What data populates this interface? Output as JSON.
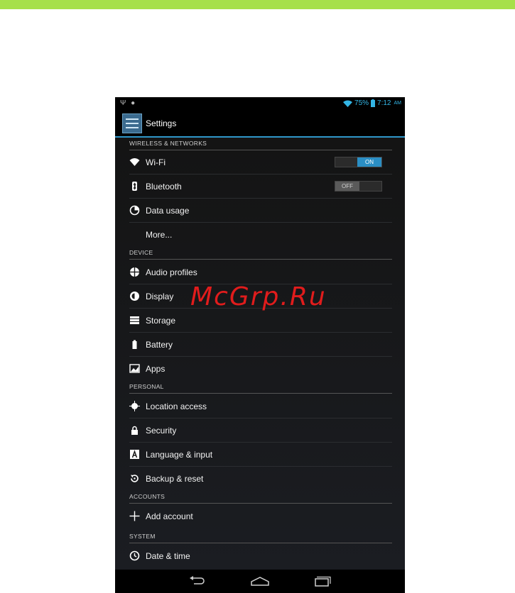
{
  "status_bar": {
    "usb_icon": "usb-icon",
    "android_icon": "android-debug-icon",
    "battery_percent": "75%",
    "time": "7:12",
    "ampm": "AM"
  },
  "action_bar": {
    "title": "Settings",
    "icon": "settings-sliders-icon"
  },
  "sections": [
    {
      "header": "WIRELESS & NETWORKS",
      "items": [
        {
          "label": "Wi-Fi",
          "icon": "wifi-icon",
          "toggle": "ON"
        },
        {
          "label": "Bluetooth",
          "icon": "bluetooth-icon",
          "toggle": "OFF"
        },
        {
          "label": "Data usage",
          "icon": "data-usage-icon"
        },
        {
          "label": "More..."
        }
      ]
    },
    {
      "header": "DEVICE",
      "items": [
        {
          "label": "Audio profiles",
          "icon": "audio-profiles-icon"
        },
        {
          "label": "Display",
          "icon": "display-brightness-icon"
        },
        {
          "label": "Storage",
          "icon": "storage-icon"
        },
        {
          "label": "Battery",
          "icon": "battery-icon"
        },
        {
          "label": "Apps",
          "icon": "apps-icon"
        }
      ]
    },
    {
      "header": "PERSONAL",
      "items": [
        {
          "label": "Location access",
          "icon": "location-icon"
        },
        {
          "label": "Security",
          "icon": "lock-icon"
        },
        {
          "label": "Language & input",
          "icon": "language-icon"
        },
        {
          "label": "Backup & reset",
          "icon": "backup-reset-icon"
        }
      ]
    },
    {
      "header": "ACCOUNTS",
      "items": [
        {
          "label": "Add account",
          "icon": "plus-icon"
        }
      ]
    },
    {
      "header": "SYSTEM",
      "items": [
        {
          "label": "Date & time",
          "icon": "clock-icon"
        }
      ]
    }
  ],
  "nav_bar": {
    "back": "back-icon",
    "home": "home-icon",
    "recents": "recents-icon"
  },
  "watermark": "McGrp.Ru",
  "colors": {
    "accent": "#33b5e5",
    "toggle_on": "#2a8ec4",
    "top_band": "#a6e04a",
    "watermark": "#e11c1c"
  }
}
